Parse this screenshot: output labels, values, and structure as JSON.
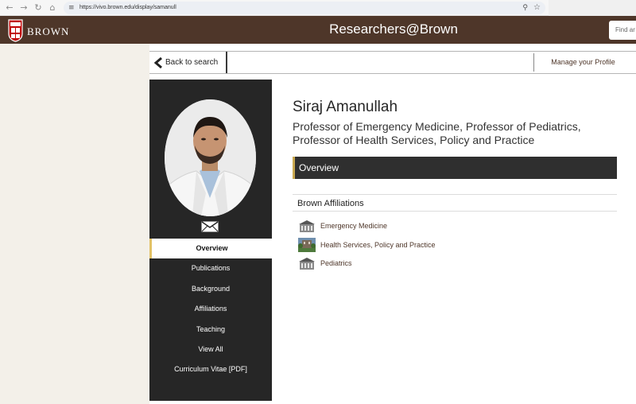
{
  "browser": {
    "url": "https://vivo.brown.edu/display/samanull",
    "icons": [
      "back-arrow-icon",
      "forward-arrow-icon",
      "reload-icon",
      "home-icon",
      "site-settings-icon",
      "zoom-icon",
      "bookmark-star-icon"
    ]
  },
  "header": {
    "logo_text": "BROWN",
    "site_title": "Researchers@Brown",
    "search_placeholder": "Find ar",
    "bg_color": "#4e3629"
  },
  "topnav": {
    "back_label": "Back to search",
    "manage_label": "Manage your Profile"
  },
  "profile": {
    "name": "Siraj Amanullah",
    "title": "Professor of Emergency Medicine, Professor of Pediatrics, Professor of Health Services, Policy and Practice"
  },
  "sidebar": {
    "items": [
      {
        "label": "Overview",
        "active": true
      },
      {
        "label": "Publications"
      },
      {
        "label": "Background"
      },
      {
        "label": "Affiliations"
      },
      {
        "label": "Teaching"
      },
      {
        "label": "View All"
      },
      {
        "label": "Curriculum Vitae [PDF]"
      }
    ]
  },
  "overview": {
    "section_label": "Overview",
    "affiliations_heading": "Brown Affiliations",
    "affiliations": [
      {
        "label": "Emergency Medicine",
        "icon": "building-icon"
      },
      {
        "label": "Health Services, Policy and Practice",
        "icon": "campus-photo-icon"
      },
      {
        "label": "Pediatrics",
        "icon": "building-icon"
      }
    ]
  },
  "colors": {
    "brown": "#4e3629",
    "sidebar": "#262626",
    "accent_gold": "#c9a84f",
    "beige": "#f3f0e9"
  }
}
